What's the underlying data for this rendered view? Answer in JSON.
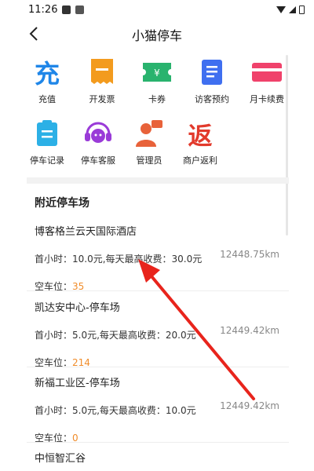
{
  "status": {
    "time": "11:26"
  },
  "header": {
    "title": "小猫停车",
    "back_icon": "chevron-left-icon"
  },
  "menu": [
    {
      "label": "充值",
      "icon": "recharge-icon",
      "glyph": "充",
      "color": "#1f86e8"
    },
    {
      "label": "开发票",
      "icon": "invoice-icon",
      "color": "#f39b1e"
    },
    {
      "label": "卡券",
      "icon": "coupon-icon",
      "color": "#29b36e"
    },
    {
      "label": "访客预约",
      "icon": "visitor-booking-icon",
      "color": "#3f6ff0"
    },
    {
      "label": "月卡续费",
      "icon": "monthly-card-icon",
      "color": "#f0426b"
    },
    {
      "label": "停车记录",
      "icon": "parking-record-icon",
      "color": "#2cb0e6"
    },
    {
      "label": "停车客服",
      "icon": "customer-service-icon",
      "color": "#9a3bd8"
    },
    {
      "label": "管理员",
      "icon": "admin-icon",
      "color": "#e8623a"
    },
    {
      "label": "商户返利",
      "icon": "rebate-icon",
      "glyph": "返",
      "color": "#e23a2c"
    }
  ],
  "nearby": {
    "title": "附近停车场",
    "free_label": "空车位：",
    "lots": [
      {
        "name": "博客格兰云天国际酒店",
        "fee": "首小时：10.0元,每天最高收费：30.0元",
        "free": "35",
        "distance": "12448.75km"
      },
      {
        "name": "凯达安中心-停车场",
        "fee": "首小时：5.0元,每天最高收费：20.0元",
        "free": "214",
        "distance": "12449.42km"
      },
      {
        "name": "新福工业区-停车场",
        "fee": "首小时：5.0元,每天最高收费：10.0元",
        "free": "0",
        "distance": "12449.42km"
      },
      {
        "name": "中恒智汇谷"
      }
    ]
  },
  "colors": {
    "accent_orange": "#f08c2a",
    "annotation_red": "#e8241c"
  }
}
